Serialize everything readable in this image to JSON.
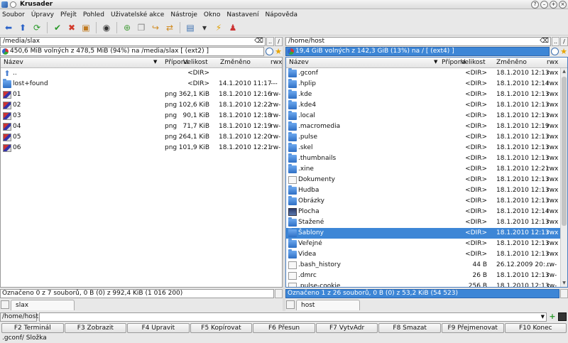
{
  "window": {
    "title": "Krusader"
  },
  "menu": [
    "Soubor",
    "Úpravy",
    "Přejít",
    "Pohled",
    "Uživatelské akce",
    "Nástroje",
    "Okno",
    "Nastavení",
    "Nápověda"
  ],
  "toolbar": [
    {
      "name": "back-icon",
      "glyph": "⬅",
      "color": "#2a62c8"
    },
    {
      "name": "up-icon",
      "glyph": "⬆",
      "color": "#2a62c8"
    },
    {
      "name": "refresh-icon",
      "glyph": "⟳",
      "color": "#2a9a2a"
    },
    {
      "name": "sep"
    },
    {
      "name": "select-all-icon",
      "glyph": "✔",
      "color": "#2a9a2a"
    },
    {
      "name": "unselect-icon",
      "glyph": "✖",
      "color": "#d23a2a"
    },
    {
      "name": "compare-icon",
      "glyph": "▣",
      "color": "#c07a20"
    },
    {
      "name": "sep"
    },
    {
      "name": "search-icon",
      "glyph": "◉",
      "color": "#333"
    },
    {
      "name": "sep"
    },
    {
      "name": "new-file-icon",
      "glyph": "⊕",
      "color": "#4aa040"
    },
    {
      "name": "copy-icon",
      "glyph": "❐",
      "color": "#888"
    },
    {
      "name": "move-icon",
      "glyph": "↪",
      "color": "#d08a20"
    },
    {
      "name": "sync-icon",
      "glyph": "⇄",
      "color": "#d08a20"
    },
    {
      "name": "sep"
    },
    {
      "name": "terminal-icon",
      "glyph": "▤",
      "color": "#3a6fb0"
    },
    {
      "name": "dropdown-icon",
      "glyph": "▾",
      "color": "#333"
    },
    {
      "name": "mount-icon",
      "glyph": "⚡",
      "color": "#e0a000"
    },
    {
      "name": "root-icon",
      "glyph": "♟",
      "color": "#c33"
    }
  ],
  "columns": {
    "name": "Název",
    "ext": "Přípona",
    "size": "Velikost",
    "modified": "Změněno",
    "perm": "rwx"
  },
  "left": {
    "path": "/media/slax",
    "info": "450,6 MiB volných z 478,5 MiB (94%) na /media/slax [ (ext2) ]",
    "status": "Označeno 0 z 7 souborů, 0 B  (0) z 992,4 KiB (1 016 200)",
    "tab": "slax",
    "rows": [
      {
        "icon": "up",
        "name": "..",
        "ext": "",
        "size": "<DIR>",
        "date": "",
        "perm": ""
      },
      {
        "icon": "folder",
        "name": "lost+found",
        "ext": "",
        "size": "<DIR>",
        "date": "14.1.2010 11:17",
        "perm": "---"
      },
      {
        "icon": "png",
        "name": "01",
        "ext": "png",
        "size": "362,1 KiB",
        "date": "18.1.2010 12:16",
        "perm": "rw-"
      },
      {
        "icon": "png",
        "name": "02",
        "ext": "png",
        "size": "102,6 KiB",
        "date": "18.1.2010 12:22",
        "perm": "rw-"
      },
      {
        "icon": "png",
        "name": "03",
        "ext": "png",
        "size": "90,1 KiB",
        "date": "18.1.2010 12:18",
        "perm": "rw-"
      },
      {
        "icon": "png",
        "name": "04",
        "ext": "png",
        "size": "71,7 KiB",
        "date": "18.1.2010 12:19",
        "perm": "rw-"
      },
      {
        "icon": "png",
        "name": "05",
        "ext": "png",
        "size": "264,1 KiB",
        "date": "18.1.2010 12:20",
        "perm": "rw-"
      },
      {
        "icon": "png",
        "name": "06",
        "ext": "png",
        "size": "101,9 KiB",
        "date": "18.1.2010 12:21",
        "perm": "rw-"
      }
    ]
  },
  "right": {
    "path": "/home/host",
    "info": "19,4 GiB volných z 142,3 GiB (13%) na / [ (ext4) ]",
    "status": "Označeno 1 z 26 souborů, 0 B  (0) z 53,2 KiB (54 523)",
    "tab": "host",
    "rows": [
      {
        "icon": "folder",
        "name": ".gconf",
        "size": "<DIR>",
        "date": "18.1.2010 12:13",
        "perm": "rwx"
      },
      {
        "icon": "folder",
        "name": ".hplip",
        "size": "<DIR>",
        "date": "18.1.2010 12:14",
        "perm": "rwx"
      },
      {
        "icon": "folder",
        "name": ".kde",
        "size": "<DIR>",
        "date": "18.1.2010 12:13",
        "perm": "rwx"
      },
      {
        "icon": "folder",
        "name": ".kde4",
        "size": "<DIR>",
        "date": "18.1.2010 12:13",
        "perm": "rwx"
      },
      {
        "icon": "folder",
        "name": ".local",
        "size": "<DIR>",
        "date": "18.1.2010 12:13",
        "perm": "rwx"
      },
      {
        "icon": "folder",
        "name": ".macromedia",
        "size": "<DIR>",
        "date": "18.1.2010 12:19",
        "perm": "rwx"
      },
      {
        "icon": "folder",
        "name": ".pulse",
        "size": "<DIR>",
        "date": "18.1.2010 12:13",
        "perm": "rwx"
      },
      {
        "icon": "folder",
        "name": ".skel",
        "size": "<DIR>",
        "date": "18.1.2010 12:13",
        "perm": "rwx"
      },
      {
        "icon": "folder",
        "name": ".thumbnails",
        "size": "<DIR>",
        "date": "18.1.2010 12:13",
        "perm": "rwx"
      },
      {
        "icon": "folder",
        "name": ".xine",
        "size": "<DIR>",
        "date": "18.1.2010 12:21",
        "perm": "rwx"
      },
      {
        "icon": "doc",
        "name": "Dokumenty",
        "size": "<DIR>",
        "date": "18.1.2010 12:13",
        "perm": "rwx"
      },
      {
        "icon": "folder",
        "name": "Hudba",
        "size": "<DIR>",
        "date": "18.1.2010 12:13",
        "perm": "rwx"
      },
      {
        "icon": "folder",
        "name": "Obrázky",
        "size": "<DIR>",
        "date": "18.1.2010 12:13",
        "perm": "rwx"
      },
      {
        "icon": "desktop",
        "name": "Plocha",
        "size": "<DIR>",
        "date": "18.1.2010 12:14",
        "perm": "rwx"
      },
      {
        "icon": "folder",
        "name": "Stažené",
        "size": "<DIR>",
        "date": "18.1.2010 12:13",
        "perm": "rwx"
      },
      {
        "icon": "folder",
        "name": "Šablony",
        "size": "<DIR>",
        "date": "18.1.2010 12:13",
        "perm": "rwx",
        "selected": true
      },
      {
        "icon": "folder",
        "name": "Veřejné",
        "size": "<DIR>",
        "date": "18.1.2010 12:13",
        "perm": "rwx"
      },
      {
        "icon": "folder",
        "name": "Videa",
        "size": "<DIR>",
        "date": "18.1.2010 12:13",
        "perm": "rwx"
      },
      {
        "icon": "doc",
        "name": ".bash_history",
        "size": "44 B",
        "date": "26.12.2009 20:...",
        "perm": "rw-"
      },
      {
        "icon": "doc",
        "name": ".dmrc",
        "size": "26 B",
        "date": "18.1.2010 12:13",
        "perm": "rw-"
      },
      {
        "icon": "doc",
        "name": ".pulse-cookie",
        "size": "256 B",
        "date": "18.1.2010 12:13",
        "perm": "rw-"
      }
    ]
  },
  "cmdline": {
    "label": "/home/host>"
  },
  "fkeys": [
    "F2 Terminál",
    "F3 Zobrazit",
    "F4 Upravit",
    "F5 Kopírovat",
    "F6 Přesun",
    "F7 VytvAdr",
    "F8 Smazat",
    "F9 Přejmenovat",
    "F10 Konec"
  ],
  "bottom_status": ".gconf/  Složka"
}
